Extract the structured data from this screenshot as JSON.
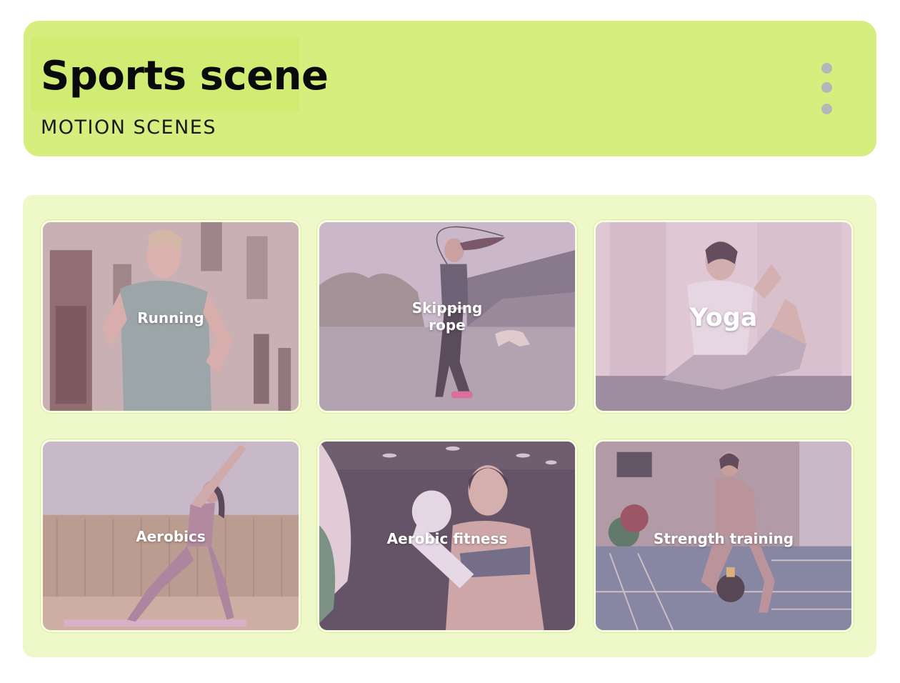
{
  "header": {
    "title": "Sports scene",
    "subtitle": "MOTION SCENES",
    "menu_icon": "more-vertical-icon"
  },
  "scenes": [
    {
      "label": "Running"
    },
    {
      "label": "Skipping\nrope"
    },
    {
      "label": "Yoga"
    },
    {
      "label": "Aerobics"
    },
    {
      "label": "Aerobic fitness"
    },
    {
      "label": "Strength training"
    }
  ]
}
